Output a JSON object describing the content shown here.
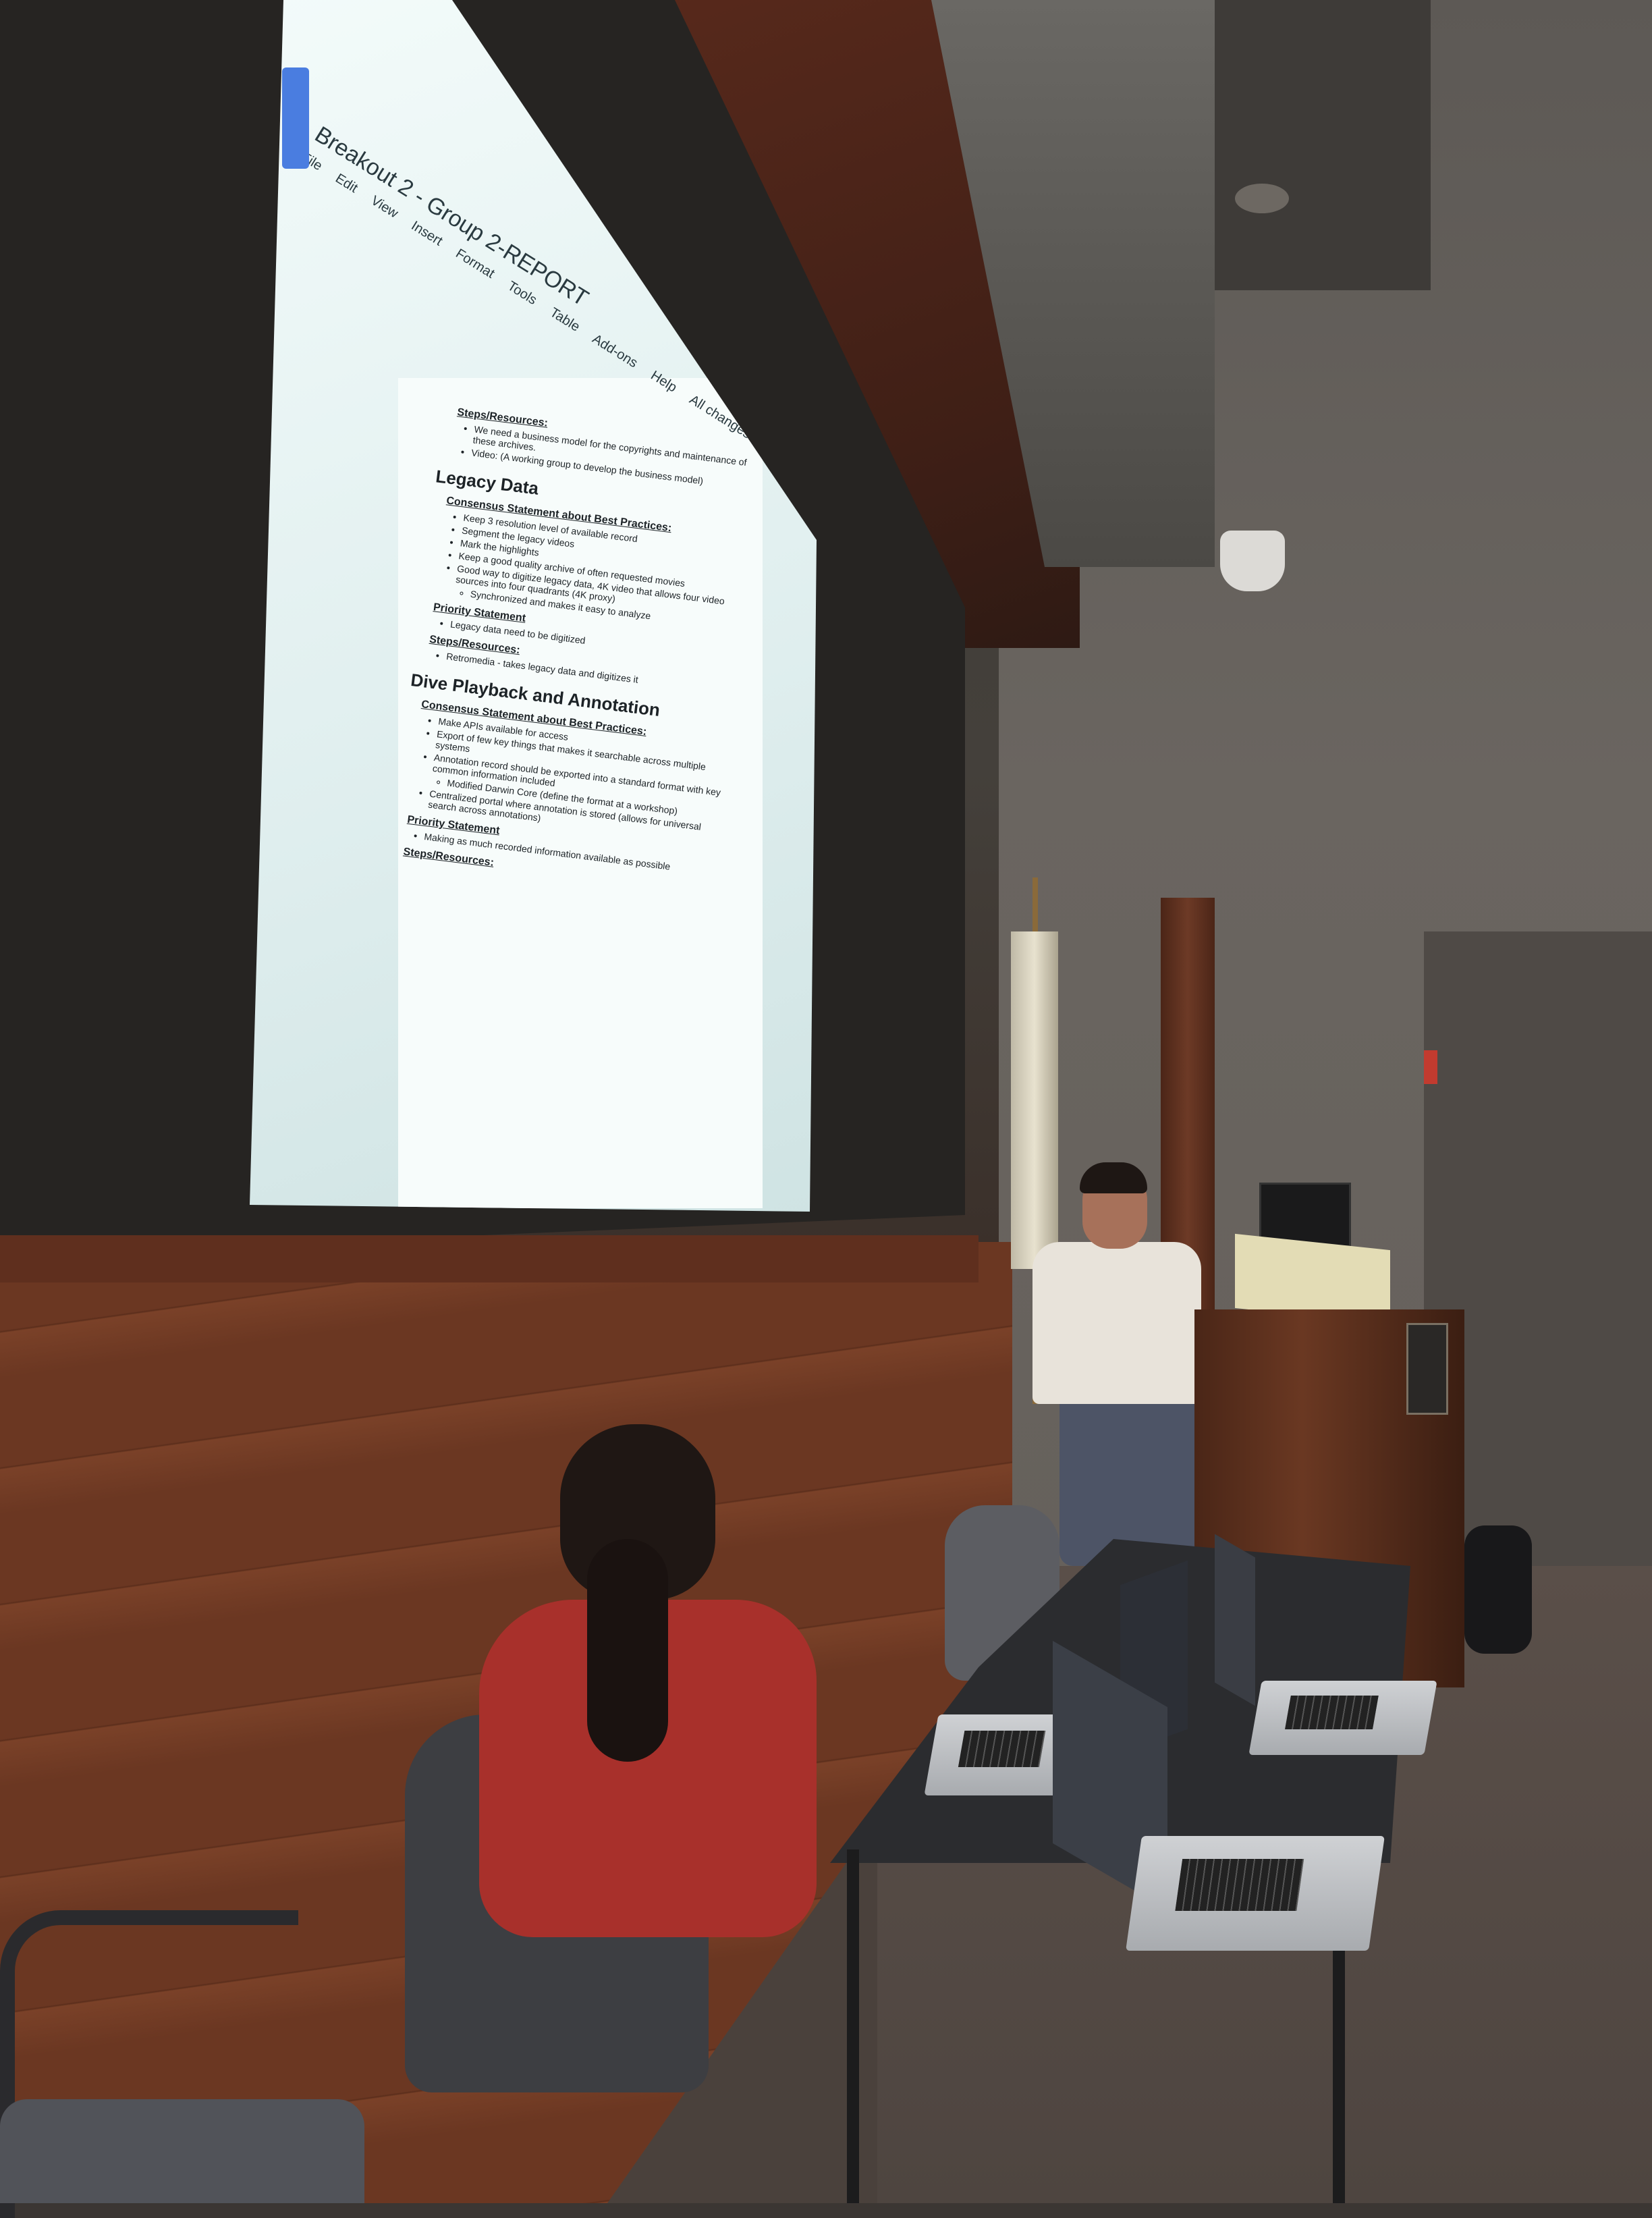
{
  "document": {
    "title": "Breakout 2 - Group 2-REPORT",
    "menu": [
      "File",
      "Edit",
      "View",
      "Insert",
      "Format",
      "Tools",
      "Table",
      "Add-ons",
      "Help",
      "All changes saved in Drive"
    ],
    "sections": [
      {
        "heading": "",
        "subsections": [
          {
            "title": "Steps/Resources:",
            "items": [
              "We need a business model for the copyrights and maintenance of these archives.",
              "Video: (A working group to develop the business model)"
            ]
          }
        ]
      },
      {
        "heading": "Legacy Data",
        "subsections": [
          {
            "title": "Consensus Statement about Best Practices:",
            "items": [
              "Keep 3 resolution level of available record",
              "Segment the legacy videos",
              "Mark the highlights",
              "Keep a good quality archive of often requested movies",
              "Good way to digitize legacy data, 4K video that allows four video sources into four quadrants (4K proxy)"
            ],
            "subitems": [
              "Synchronized and makes it easy to analyze"
            ]
          },
          {
            "title": "Priority Statement",
            "items": [
              "Legacy data need to be digitized"
            ]
          },
          {
            "title": "Steps/Resources:",
            "items": [
              "Retromedia - takes legacy data and digitizes it"
            ]
          }
        ]
      },
      {
        "heading": "Dive Playback and Annotation",
        "subsections": [
          {
            "title": "Consensus Statement about Best Practices:",
            "items": [
              "Make APIs available for access",
              "Export of few key things that makes it searchable across multiple systems",
              "Annotation record should be exported into a standard format with key common information included"
            ],
            "subitems": [
              "Modified Darwin Core (define the format at a workshop)"
            ],
            "items2": [
              "Centralized portal where annotation is stored (allows for universal search across annotations)"
            ]
          },
          {
            "title": "Priority Statement",
            "items": [
              "Making as much recorded information available as possible"
            ]
          },
          {
            "title": "Steps/Resources:",
            "items": []
          }
        ]
      }
    ]
  },
  "colors": {
    "projection": "#e6f3f2",
    "wood_panel": "#6b3722",
    "wall": "#66615c",
    "docs_blue": "#4a7de0"
  }
}
